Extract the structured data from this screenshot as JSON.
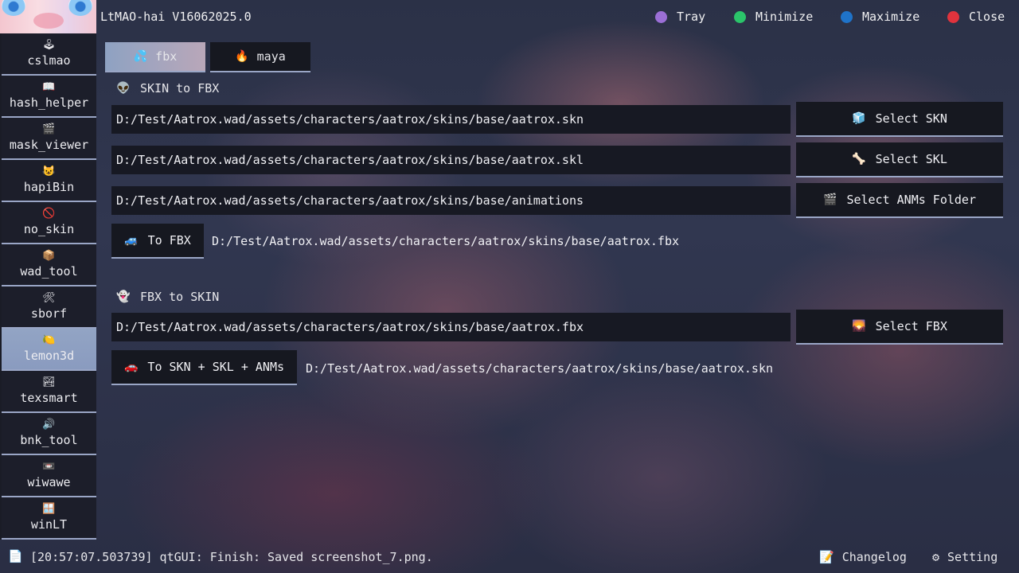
{
  "window": {
    "title": "LtMAO-hai V16062025.0",
    "controls": [
      {
        "label": "Tray",
        "color": "#9b6fd6"
      },
      {
        "label": "Minimize",
        "color": "#2bc46a"
      },
      {
        "label": "Maximize",
        "color": "#1f73c9"
      },
      {
        "label": "Close",
        "color": "#e0333d"
      }
    ]
  },
  "sidebar": {
    "items": [
      {
        "label": "cslmao",
        "icon": "🕹"
      },
      {
        "label": "hash_helper",
        "icon": "📖"
      },
      {
        "label": "mask_viewer",
        "icon": "🎬"
      },
      {
        "label": "hapiBin",
        "icon": "😺"
      },
      {
        "label": "no_skin",
        "icon": "🚫"
      },
      {
        "label": "wad_tool",
        "icon": "📦"
      },
      {
        "label": "sborf",
        "icon": "🛠"
      },
      {
        "label": "lemon3d",
        "icon": "🍋"
      },
      {
        "label": "texsmart",
        "icon": "🏞"
      },
      {
        "label": "bnk_tool",
        "icon": "🔊"
      },
      {
        "label": "wiwawe",
        "icon": "📼"
      },
      {
        "label": "winLT",
        "icon": "🪟"
      }
    ],
    "active": "lemon3d"
  },
  "tabs": [
    {
      "label": "fbx",
      "icon": "💦"
    },
    {
      "label": "maya",
      "icon": "🔥"
    }
  ],
  "skin_to_fbx": {
    "heading": "SKIN to FBX",
    "heading_icon": "👽",
    "skn_path": "D:/Test/Aatrox.wad/assets/characters/aatrox/skins/base/aatrox.skn",
    "skl_path": "D:/Test/Aatrox.wad/assets/characters/aatrox/skins/base/aatrox.skl",
    "anm_path": "D:/Test/Aatrox.wad/assets/characters/aatrox/skins/base/animations",
    "select_skn": "Select SKN",
    "select_skn_icon": "🧊",
    "select_skl": "Select SKL",
    "select_skl_icon": "🦴",
    "select_anm": "Select ANMs Folder",
    "select_anm_icon": "🎬",
    "convert_label": "To FBX",
    "convert_icon": "🚙",
    "output_path": "D:/Test/Aatrox.wad/assets/characters/aatrox/skins/base/aatrox.fbx"
  },
  "fbx_to_skin": {
    "heading": "FBX to SKIN",
    "heading_icon": "👻",
    "fbx_path": "D:/Test/Aatrox.wad/assets/characters/aatrox/skins/base/aatrox.fbx",
    "select_fbx": "Select FBX",
    "select_fbx_icon": "🌄",
    "convert_label": "To SKN + SKL + ANMs",
    "convert_icon": "🚗",
    "output_path": "D:/Test/Aatrox.wad/assets/characters/aatrox/skins/base/aatrox.skn"
  },
  "statusbar": {
    "log_icon": "📄",
    "log": "[20:57:07.503739] qtGUI: Finish: Saved screenshot_7.png.",
    "changelog": "Changelog",
    "changelog_icon": "📝",
    "setting": "Setting",
    "setting_icon": "⚙"
  }
}
